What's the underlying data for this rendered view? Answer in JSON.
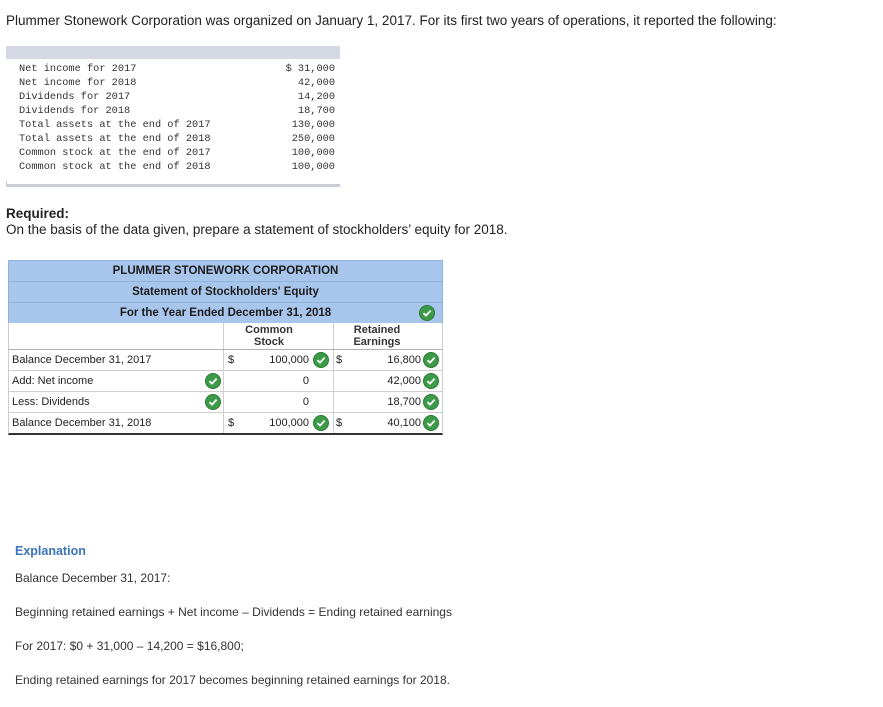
{
  "intro": "Plummer Stonework Corporation was organized on January 1, 2017. For its first two years of operations, it reported the following:",
  "given": [
    {
      "label": "Net income for 2017",
      "value": "$ 31,000"
    },
    {
      "label": "Net income for 2018",
      "value": "42,000"
    },
    {
      "label": "Dividends for 2017",
      "value": "14,200"
    },
    {
      "label": "Dividends for 2018",
      "value": "18,700"
    },
    {
      "label": "Total assets at the end of 2017",
      "value": "130,000"
    },
    {
      "label": "Total assets at the end of 2018",
      "value": "250,000"
    },
    {
      "label": "Common stock at the end of 2017",
      "value": "100,000"
    },
    {
      "label": "Common stock at the end of 2018",
      "value": "100,000"
    }
  ],
  "required": {
    "title": "Required:",
    "text": "On the basis of the data given, prepare a statement of stockholders’ equity for 2018."
  },
  "statement": {
    "company": "PLUMMER STONEWORK CORPORATION",
    "title": "Statement of Stockholders' Equity",
    "period": "For the Year Ended December 31, 2018",
    "col_common": "Common\nStock",
    "col_retained": "Retained\nEarnings",
    "rows": [
      {
        "label": "Balance December 31, 2017",
        "cs_dollar": "$",
        "cs": "100,000",
        "re_dollar": "$",
        "re": "16,800"
      },
      {
        "label": "Add: Net income",
        "cs_dollar": "",
        "cs": "0",
        "re_dollar": "",
        "re": "42,000"
      },
      {
        "label": "Less: Dividends",
        "cs_dollar": "",
        "cs": "0",
        "re_dollar": "",
        "re": "18,700"
      },
      {
        "label": "Balance December 31, 2018",
        "cs_dollar": "$",
        "cs": "100,000",
        "re_dollar": "$",
        "re": "40,100"
      }
    ],
    "check_color": "#3c9a48"
  },
  "explanation": {
    "title": "Explanation",
    "lines": [
      "Balance December 31, 2017:",
      "Beginning retained earnings + Net income – Dividends = Ending retained earnings",
      "For 2017: $0 + 31,000 – 14,200 = $16,800;",
      "Ending retained earnings for 2017 becomes beginning retained earnings for 2018."
    ]
  }
}
